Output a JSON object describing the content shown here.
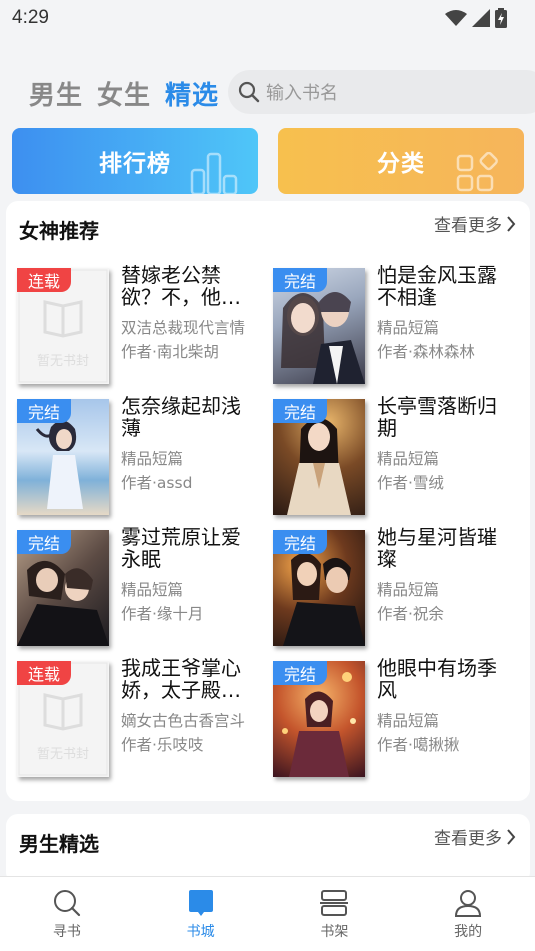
{
  "status": {
    "time": "4:29"
  },
  "tabs": [
    {
      "label": "男生",
      "active": false
    },
    {
      "label": "女生",
      "active": false
    },
    {
      "label": "精选",
      "active": true
    }
  ],
  "search": {
    "placeholder": "输入书名"
  },
  "quick_buttons": {
    "rank_label": "排行榜",
    "category_label": "分类"
  },
  "section_female": {
    "title": "女神推荐",
    "more_label": "查看更多",
    "books": [
      {
        "title": "替嫁老公禁欲？不，他…",
        "category": "双洁总裁现代言情",
        "author": "作者·南北柴胡",
        "badge": "连载",
        "cover": "placeholder",
        "placeholder_text": "暂无书封"
      },
      {
        "title": "怕是金风玉露不相逢",
        "category": "精品短篇",
        "author": "作者·森林森林",
        "badge": "完结",
        "cover": "couple"
      },
      {
        "title": "怎奈缘起却浅薄",
        "category": "精品短篇",
        "author": "作者·assd",
        "badge": "完结",
        "cover": "beach"
      },
      {
        "title": "长亭雪落断归期",
        "category": "精品短篇",
        "author": "作者·雪绒",
        "badge": "完结",
        "cover": "lady"
      },
      {
        "title": "雾过荒原让爱永眠",
        "category": "精品短篇",
        "author": "作者·缘十月",
        "badge": "完结",
        "cover": "couple-dark"
      },
      {
        "title": "她与星河皆璀璨",
        "category": "精品短篇",
        "author": "作者·祝余",
        "badge": "完结",
        "cover": "couple-night"
      },
      {
        "title": "我成王爷掌心娇，太子殿…",
        "category": "嫡女古色古香宫斗",
        "author": "作者·乐吱吱",
        "badge": "连载",
        "cover": "placeholder",
        "placeholder_text": "暂无书封"
      },
      {
        "title": "他眼中有场季风",
        "category": "精品短篇",
        "author": "作者·噶揪揪",
        "badge": "完结",
        "cover": "lights"
      }
    ]
  },
  "section_male": {
    "title": "男生精选",
    "more_label": "查看更多"
  },
  "bottom_nav": [
    {
      "label": "寻书",
      "icon": "search-icon",
      "active": false
    },
    {
      "label": "书城",
      "icon": "book-icon",
      "active": true
    },
    {
      "label": "书架",
      "icon": "shelf-icon",
      "active": false
    },
    {
      "label": "我的",
      "icon": "profile-icon",
      "active": false
    }
  ],
  "colors": {
    "accent": "#2b8be8",
    "serial_badge": "#f04444",
    "done_badge": "#3a8ef0"
  }
}
